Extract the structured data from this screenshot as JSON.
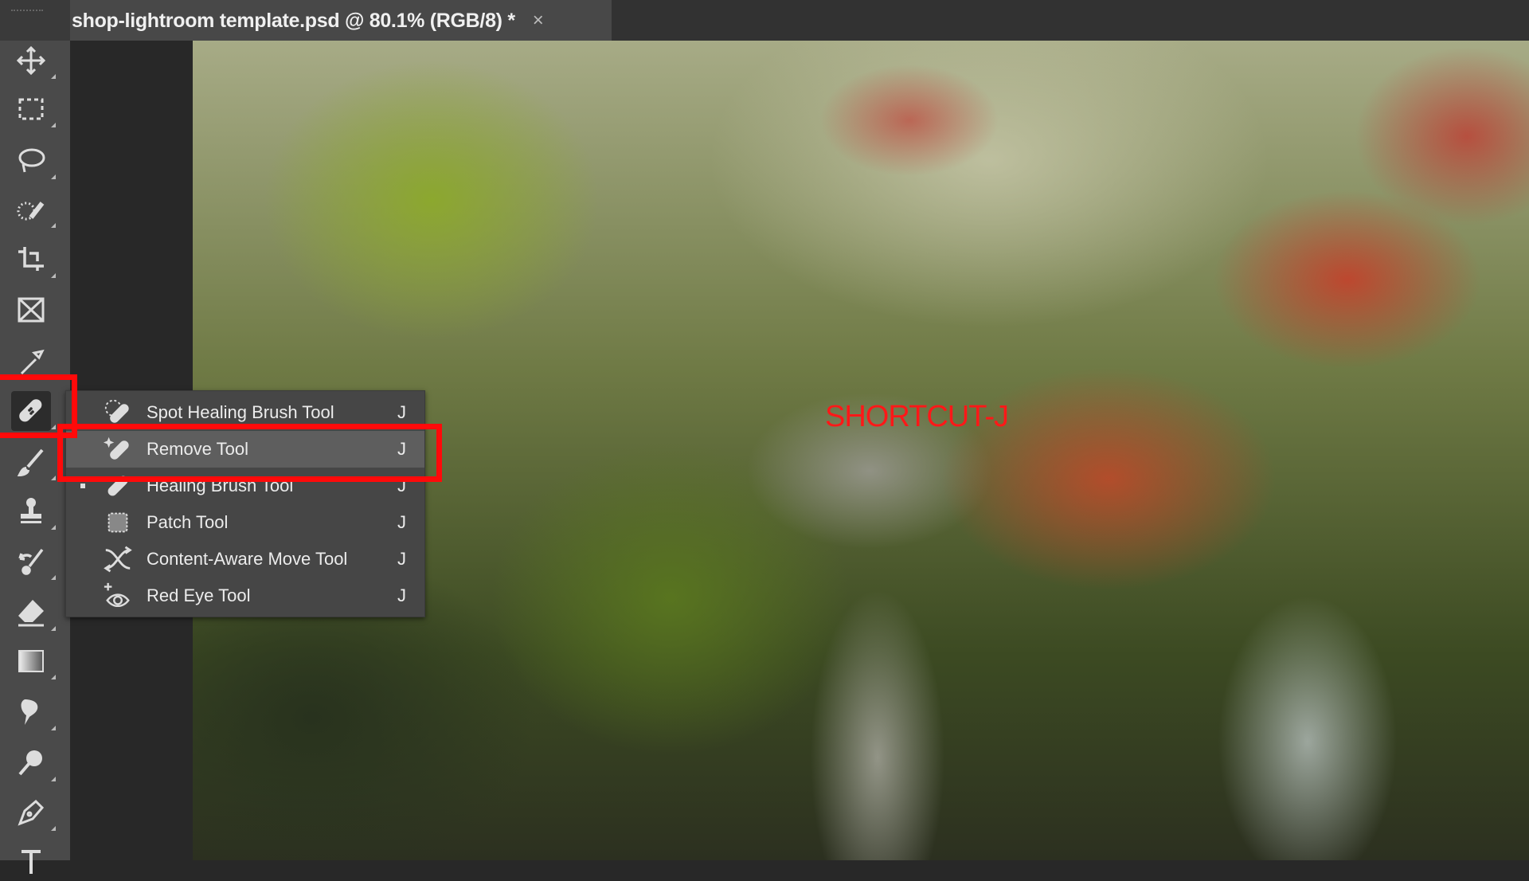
{
  "document_tab": {
    "title": "shop-lightroom template.psd @ 80.1% (RGB/8) *",
    "close_icon": "×"
  },
  "toolbar": {
    "tools": [
      "move",
      "rectangular-marquee",
      "lasso",
      "quick-selection",
      "crop",
      "frame",
      "eyedropper",
      "spot-healing-brush",
      "brush",
      "clone-stamp",
      "history-brush",
      "eraser",
      "gradient",
      "smudge",
      "dodge",
      "pen",
      "type"
    ],
    "active": "spot-healing-brush"
  },
  "flyout_menu": {
    "items": [
      {
        "label": "Spot Healing Brush Tool",
        "shortcut": "J",
        "icon": "spot-healing-icon"
      },
      {
        "label": "Remove Tool",
        "shortcut": "J",
        "icon": "remove-tool-icon",
        "highlighted": true
      },
      {
        "label": "Healing Brush Tool",
        "shortcut": "J",
        "icon": "healing-brush-icon",
        "current": true
      },
      {
        "label": "Patch Tool",
        "shortcut": "J",
        "icon": "patch-icon"
      },
      {
        "label": "Content-Aware Move Tool",
        "shortcut": "J",
        "icon": "content-aware-move-icon"
      },
      {
        "label": "Red Eye Tool",
        "shortcut": "J",
        "icon": "red-eye-icon"
      }
    ]
  },
  "annotation": {
    "text": "SHORTCUT-J",
    "color": "#ff1818"
  },
  "colors": {
    "highlight_box": "#ff0a0a",
    "panel": "#4a4a4a",
    "menu": "#464646"
  }
}
